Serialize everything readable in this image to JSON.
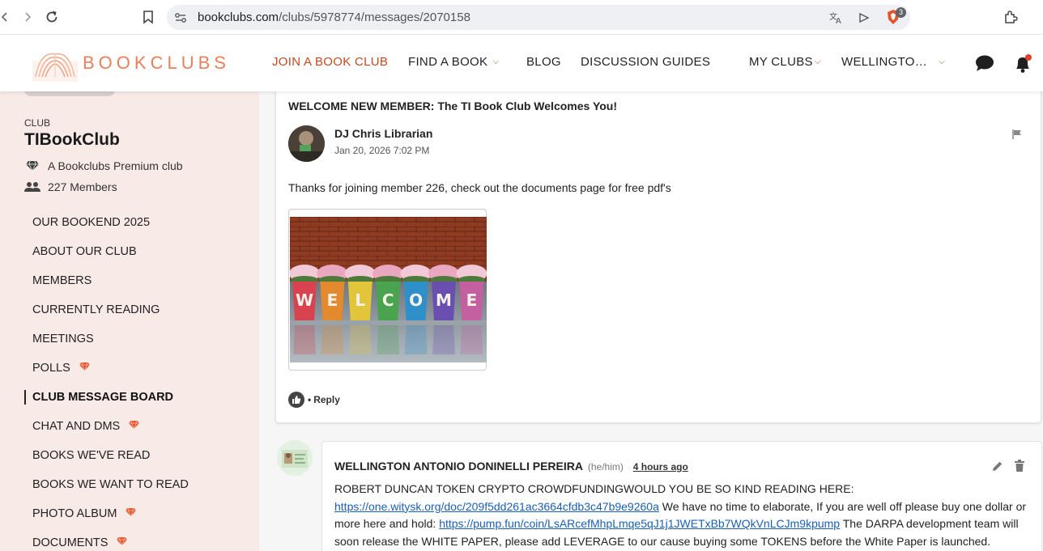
{
  "browser": {
    "url_domain": "bookclubs.com",
    "url_path": "/clubs/5978774/messages/2070158",
    "brave_badge_count": "3"
  },
  "header": {
    "logo_text": "BOOKCLUBS",
    "nav": {
      "join": "JOIN A BOOK CLUB",
      "find": "FIND A BOOK",
      "blog": "BLOG",
      "guides": "DISCUSSION GUIDES",
      "my_clubs": "MY CLUBS",
      "user": "WELLINGTO…"
    },
    "accent_color": "#c7471f"
  },
  "sidebar": {
    "club_label": "CLUB",
    "club_name": "TIBookClub",
    "premium_text": "A Bookclubs Premium club",
    "members_text": "227 Members",
    "menu": [
      {
        "label": "OUR BOOKEND 2025",
        "premium": false
      },
      {
        "label": "ABOUT OUR CLUB",
        "premium": false
      },
      {
        "label": "MEMBERS",
        "premium": false
      },
      {
        "label": "CURRENTLY READING",
        "premium": false
      },
      {
        "label": "MEETINGS",
        "premium": false
      },
      {
        "label": "POLLS",
        "premium": true
      },
      {
        "label": "CLUB MESSAGE BOARD",
        "premium": false,
        "active": true
      },
      {
        "label": "CHAT AND DMS",
        "premium": true
      },
      {
        "label": "BOOKS WE'VE READ",
        "premium": false
      },
      {
        "label": "BOOKS WE WANT TO READ",
        "premium": false
      },
      {
        "label": "PHOTO ALBUM",
        "premium": true
      },
      {
        "label": "DOCUMENTS",
        "premium": true
      }
    ]
  },
  "post": {
    "title": "WELCOME NEW MEMBER: The TI Book Club Welcomes You!",
    "author": "DJ Chris Librarian",
    "date": "Jan 20, 2026 7:02 PM",
    "body": "Thanks for joining member 226, check out the documents page for free pdf's",
    "image_letters": [
      "W",
      "E",
      "L",
      "C",
      "O",
      "M",
      "E"
    ],
    "reply_label": "Reply",
    "like_separator": "•"
  },
  "reply": {
    "author": "WELLINGTON ANTONIO DONINELLI PEREIRA",
    "pronouns": "(he/him)",
    "time": "4 hours ago",
    "text_1": "ROBERT DUNCAN TOKEN CRYPTO CROWDFUNDINGWOULD YOU BE SO KIND READING HERE: ",
    "link_1": "https://one.witysk.org/doc/209f5dd261ac3664cfdb3c47b9e9260a",
    "text_2": " We have no time to elaborate, If you are well off please buy one dollar or more here and hold: ",
    "link_2": "https://pump.fun/coin/LsARcefMhpLmqe5qJ1j1JWETxBb7WQkVnLCJm9kpump",
    "text_3": " The DARPA development team will soon release the WHITE PAPER, please add LEVERAGE to our cause buying some TOKENS before the White Paper is launched."
  }
}
